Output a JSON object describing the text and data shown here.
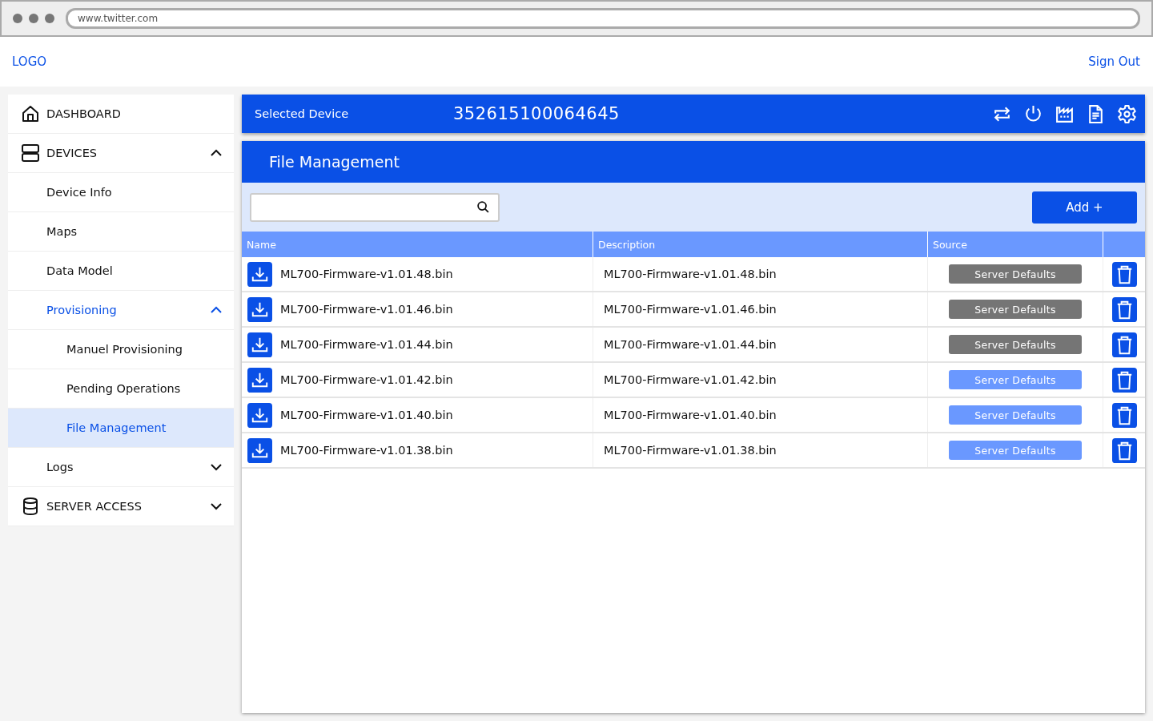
{
  "browser": {
    "url": "www.twitter.com"
  },
  "header": {
    "logo": "LOGO",
    "sign_out": "Sign Out"
  },
  "sidebar": {
    "items": [
      {
        "label": "DASHBOARD",
        "selected": false
      },
      {
        "label": "DEVICES",
        "selected": false,
        "expanded": true,
        "children": [
          {
            "label": "Device Info",
            "selected": false
          },
          {
            "label": "Maps",
            "selected": false
          },
          {
            "label": "Data Model",
            "selected": false
          },
          {
            "label": "Provisioning",
            "selected": false,
            "expanded": true,
            "children": [
              {
                "label": "Manuel Provisioning",
                "selected": false
              },
              {
                "label": "Pending Operations",
                "selected": false
              },
              {
                "label": "File Management",
                "selected": true
              }
            ]
          },
          {
            "label": "Logs",
            "selected": false,
            "expanded": false
          }
        ]
      },
      {
        "label": "SERVER ACCESS",
        "selected": false,
        "expanded": false
      }
    ]
  },
  "device_bar": {
    "label": "Selected Device",
    "device_id": "352615100064645"
  },
  "panel": {
    "title": "File Management",
    "add_button": "Add +"
  },
  "table": {
    "columns": [
      "Name",
      "Description",
      "Source"
    ],
    "rows": [
      {
        "name": "ML700-Firmware-v1.01.48.bin",
        "description": "ML700-Firmware-v1.01.48.bin",
        "source": "Server Defaults",
        "color": "#757575"
      },
      {
        "name": "ML700-Firmware-v1.01.46.bin",
        "description": "ML700-Firmware-v1.01.46.bin",
        "source": "Server Defaults",
        "color": "#757575"
      },
      {
        "name": "ML700-Firmware-v1.01.44.bin",
        "description": "ML700-Firmware-v1.01.44.bin",
        "source": "Server Defaults",
        "color": "#757575"
      },
      {
        "name": "ML700-Firmware-v1.01.42.bin",
        "description": "ML700-Firmware-v1.01.42.bin",
        "source": "Server Defaults",
        "color": "#6a98ff"
      },
      {
        "name": "ML700-Firmware-v1.01.40.bin",
        "description": "ML700-Firmware-v1.01.40.bin",
        "source": "Server Defaults",
        "color": "#6a98ff"
      },
      {
        "name": "ML700-Firmware-v1.01.38.bin",
        "description": "ML700-Firmware-v1.01.38.bin",
        "source": "Server Defaults",
        "color": "#6a98ff"
      }
    ]
  }
}
